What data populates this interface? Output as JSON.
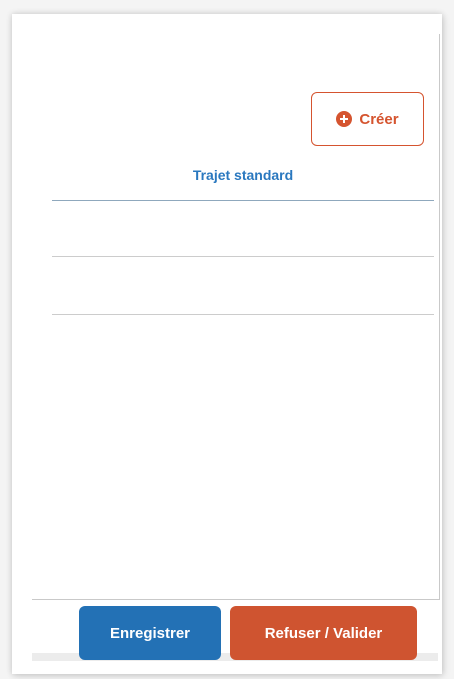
{
  "toolbar": {
    "create_label": "Créer",
    "create_icon": "plus-circle-icon"
  },
  "table": {
    "columns": [
      "Trajet standard"
    ],
    "rows": [
      [
        ""
      ],
      [
        ""
      ]
    ]
  },
  "footer": {
    "save_label": "Enregistrer",
    "validate_label": "Refuser / Valider"
  },
  "colors": {
    "accent_blue": "#2371b5",
    "accent_orange": "#cf5430",
    "header_text": "#2a78bf"
  }
}
